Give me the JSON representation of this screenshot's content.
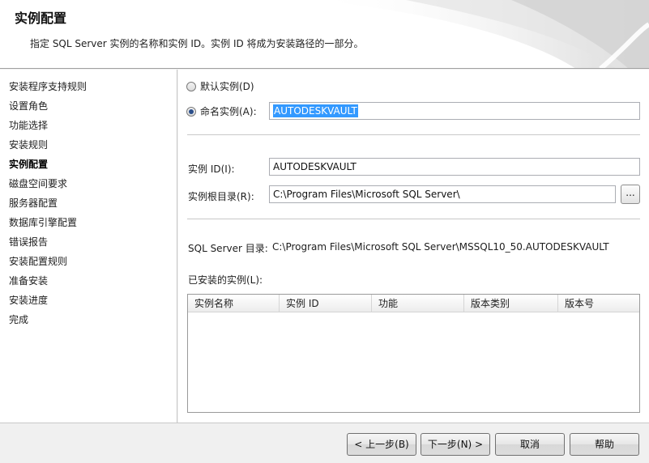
{
  "header": {
    "title": "实例配置",
    "description": "指定 SQL Server 实例的名称和实例 ID。实例 ID 将成为安装路径的一部分。"
  },
  "nav": {
    "items": [
      {
        "label": "安装程序支持规则"
      },
      {
        "label": "设置角色"
      },
      {
        "label": "功能选择"
      },
      {
        "label": "安装规则"
      },
      {
        "label": "实例配置",
        "active": true
      },
      {
        "label": "磁盘空间要求"
      },
      {
        "label": "服务器配置"
      },
      {
        "label": "数据库引擎配置"
      },
      {
        "label": "错误报告"
      },
      {
        "label": "安装配置规则"
      },
      {
        "label": "准备安装"
      },
      {
        "label": "安装进度"
      },
      {
        "label": "完成"
      }
    ]
  },
  "instance": {
    "default_label": "默认实例(D)",
    "named_label": "命名实例(A):",
    "named_value": "AUTODESKVAULT",
    "selected": "named"
  },
  "form": {
    "instance_id_label": "实例 ID(I):",
    "instance_id_value": "AUTODESKVAULT",
    "root_dir_label": "实例根目录(R):",
    "root_dir_value": "C:\\Program Files\\Microsoft SQL Server\\",
    "browse_label": "...",
    "sql_dir_label": "SQL Server 目录:",
    "sql_dir_value": "C:\\Program Files\\Microsoft SQL Server\\MSSQL10_50.AUTODESKVAULT",
    "installed_label": "已安装的实例(L):"
  },
  "table": {
    "columns": [
      "实例名称",
      "实例 ID",
      "功能",
      "版本类别",
      "版本号"
    ],
    "rows": []
  },
  "footer": {
    "back_label": "< 上一步(B)",
    "next_label": "下一步(N) >",
    "cancel_label": "取消",
    "help_label": "帮助"
  }
}
